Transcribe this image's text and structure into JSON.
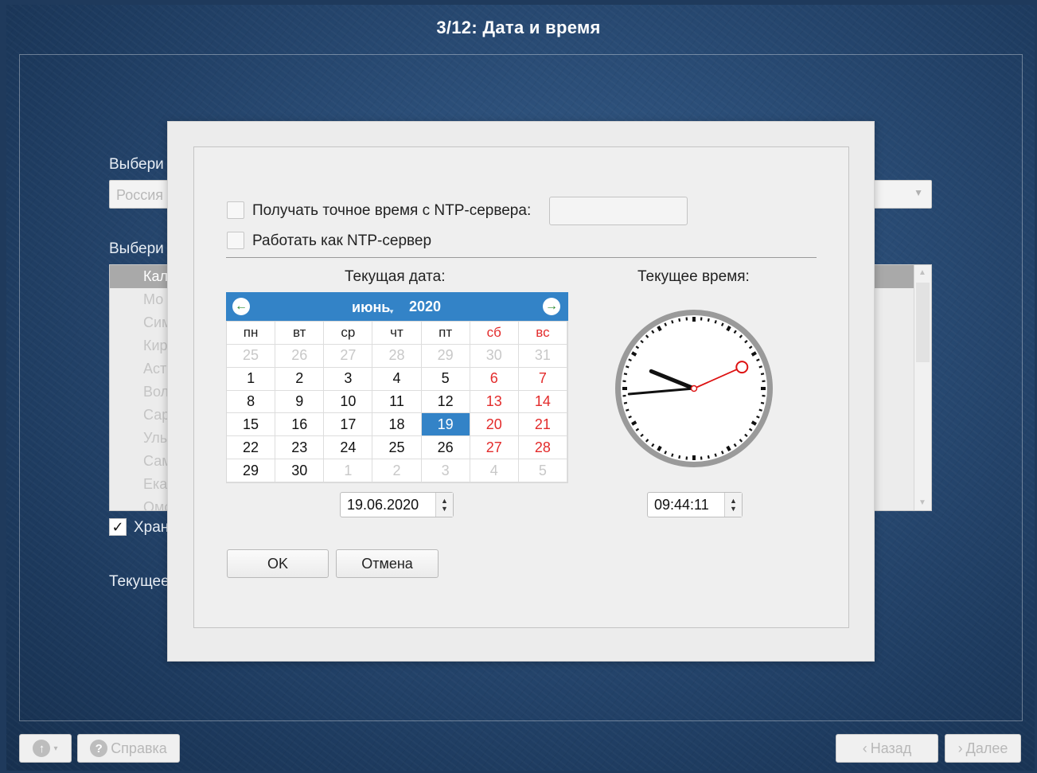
{
  "window": {
    "title": "3/12: Дата и время"
  },
  "background": {
    "label_region": "Выбери",
    "region_value": "Россия",
    "label_zone": "Выбери",
    "zone_list": [
      "Кал",
      "Мо",
      "Сим",
      "Кир",
      "Аст",
      "Вол",
      "Сар",
      "Уль",
      "Сам",
      "Ека",
      "Омс"
    ],
    "store_checkbox_label": "Хран",
    "current_label": "Текущее"
  },
  "dialog": {
    "ntp_sync_label": "Получать точное время с NTP-сервера:",
    "ntp_server_value": "",
    "ntp_serve_label": "Работать как NTP-сервер",
    "date_label": "Текущая дата:",
    "time_label": "Текущее время:",
    "calendar": {
      "month": "июнь",
      "year": "2020",
      "weekdays": [
        "пн",
        "вт",
        "ср",
        "чт",
        "пт",
        "сб",
        "вс"
      ],
      "weeks": [
        [
          "25",
          "26",
          "27",
          "28",
          "29",
          "30",
          "31"
        ],
        [
          "1",
          "2",
          "3",
          "4",
          "5",
          "6",
          "7"
        ],
        [
          "8",
          "9",
          "10",
          "11",
          "12",
          "13",
          "14"
        ],
        [
          "15",
          "16",
          "17",
          "18",
          "19",
          "20",
          "21"
        ],
        [
          "22",
          "23",
          "24",
          "25",
          "26",
          "27",
          "28"
        ],
        [
          "29",
          "30",
          "1",
          "2",
          "3",
          "4",
          "5"
        ]
      ],
      "selected_day": "19"
    },
    "date_value": "19.06.2020",
    "time_value": "09:44:11",
    "ok_label": "OK",
    "cancel_label": "Отмена"
  },
  "bottom": {
    "help_label": "Справка",
    "back_label": "Назад",
    "next_label": "Далее"
  },
  "colors": {
    "accent": "#3383c7",
    "weekend": "#e32b2b",
    "second_hand": "#dd1111"
  }
}
